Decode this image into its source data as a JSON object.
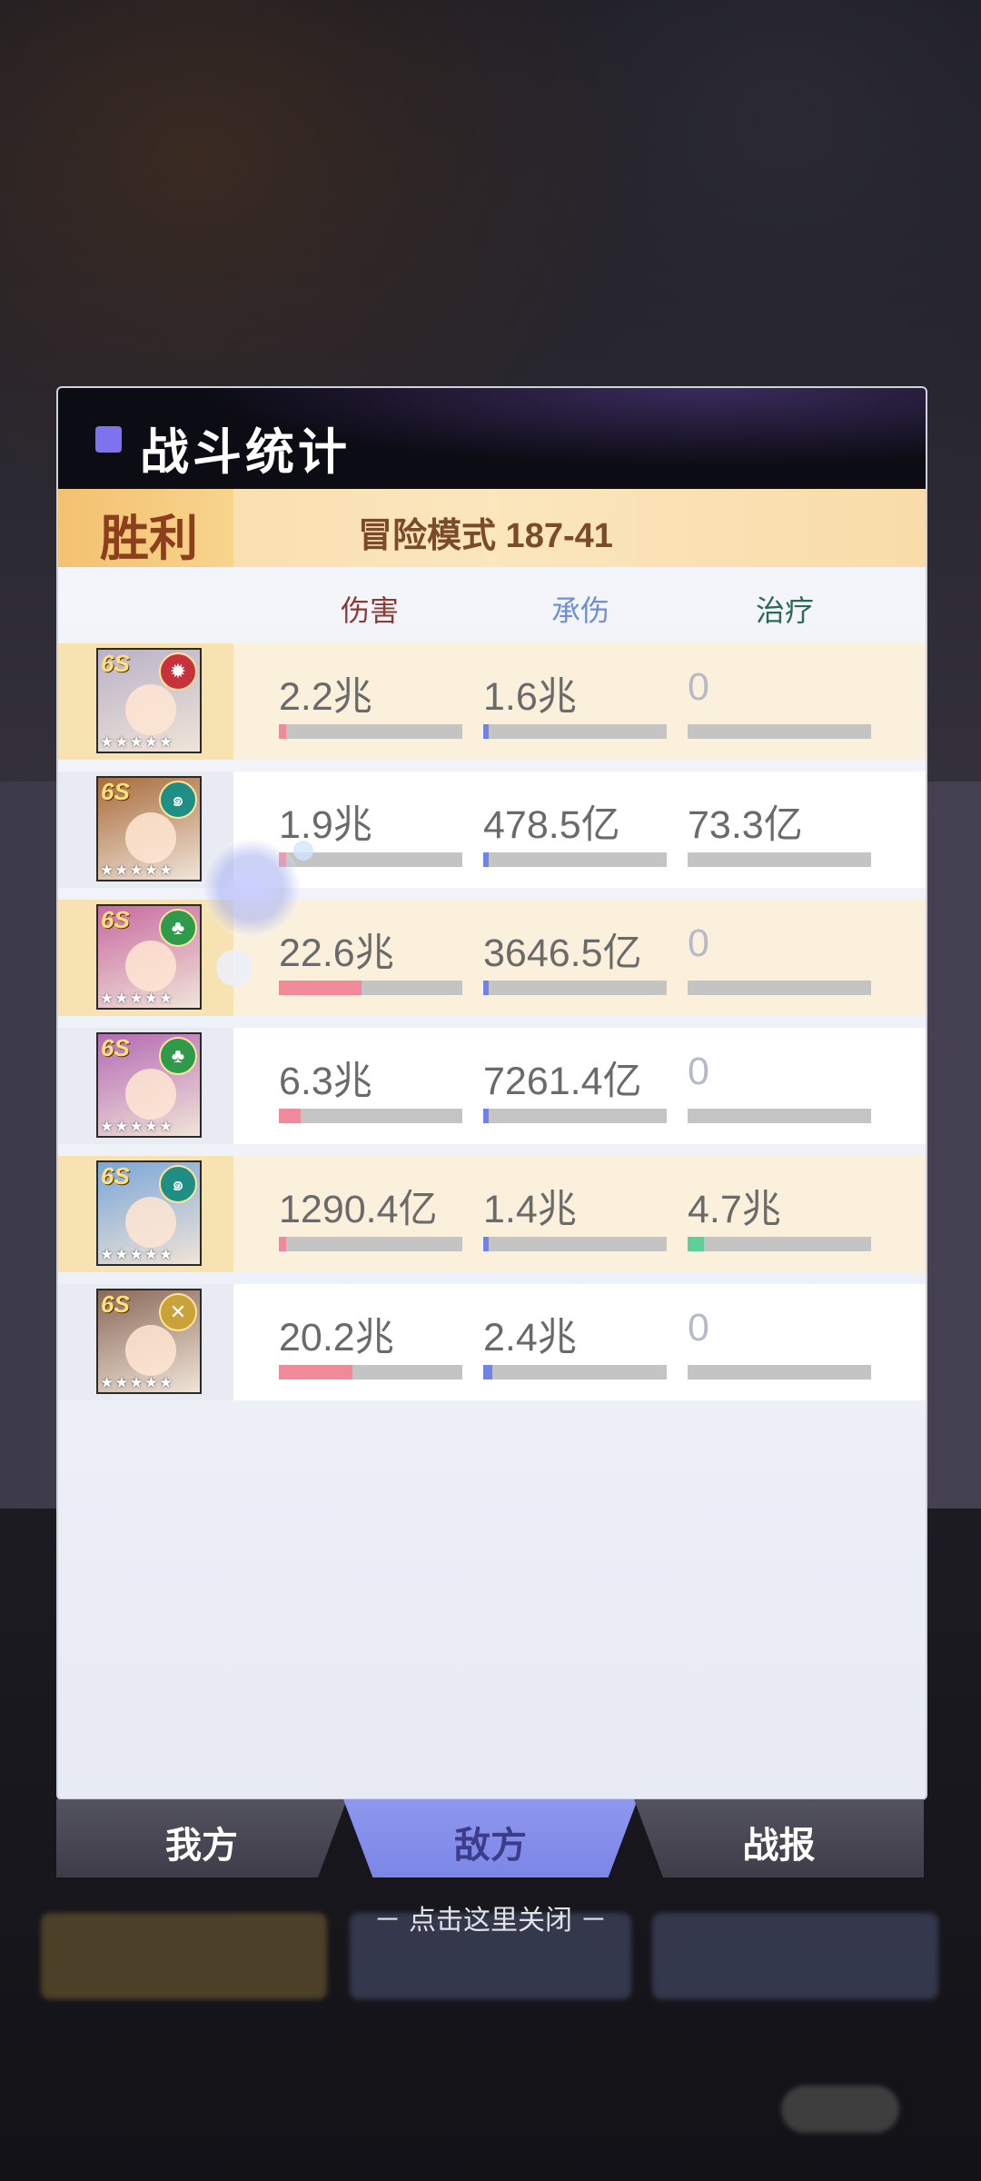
{
  "panel": {
    "title": "战斗统计",
    "result": "胜利",
    "mode": "冒险模式 187-41"
  },
  "columns": {
    "damage": "伤害",
    "taken": "承伤",
    "heal": "治疗"
  },
  "colors": {
    "damage_bar": "#f08a9a",
    "taken_bar": "#6f84e6",
    "heal_bar": "#5fcf9a",
    "active_tab": "#8a93ec"
  },
  "rows": [
    {
      "level": "6S",
      "element_icon": "fire-icon",
      "element_color": "#c8323c",
      "portrait_color": "#b9b2c8",
      "damage": "2.2兆",
      "taken": "1.6兆",
      "heal": "0",
      "damage_ratio": 0.04,
      "taken_ratio": 0.03,
      "heal_ratio": 0.0
    },
    {
      "level": "6S",
      "element_icon": "wind-icon",
      "element_color": "#1f8f86",
      "portrait_color": "#a86c3c",
      "damage": "1.9兆",
      "taken": "478.5亿",
      "heal": "73.3亿",
      "damage_ratio": 0.03,
      "taken_ratio": 0.0,
      "heal_ratio": 0.0
    },
    {
      "level": "6S",
      "element_icon": "nature-icon",
      "element_color": "#2e9a4a",
      "portrait_color": "#c86aa0",
      "damage": "22.6兆",
      "taken": "3646.5亿",
      "heal": "0",
      "damage_ratio": 0.45,
      "taken_ratio": 0.01,
      "heal_ratio": 0.0
    },
    {
      "level": "6S",
      "element_icon": "nature-icon",
      "element_color": "#2e9a4a",
      "portrait_color": "#b46ab4",
      "damage": "6.3兆",
      "taken": "7261.4亿",
      "heal": "0",
      "damage_ratio": 0.12,
      "taken_ratio": 0.02,
      "heal_ratio": 0.0
    },
    {
      "level": "6S",
      "element_icon": "wind-icon",
      "element_color": "#1f8f86",
      "portrait_color": "#7aa6d8",
      "damage": "1290.4亿",
      "taken": "1.4兆",
      "heal": "4.7兆",
      "damage_ratio": 0.0,
      "taken_ratio": 0.02,
      "heal_ratio": 0.09
    },
    {
      "level": "6S",
      "element_icon": "light-icon",
      "element_color": "#c9a23a",
      "portrait_color": "#8a6a5a",
      "damage": "20.2兆",
      "taken": "2.4兆",
      "heal": "0",
      "damage_ratio": 0.4,
      "taken_ratio": 0.05,
      "heal_ratio": 0.0
    }
  ],
  "tabs": {
    "mine": "我方",
    "enemy": "敌方",
    "report": "战报"
  },
  "close_hint": "－ 点击这里关闭 －"
}
